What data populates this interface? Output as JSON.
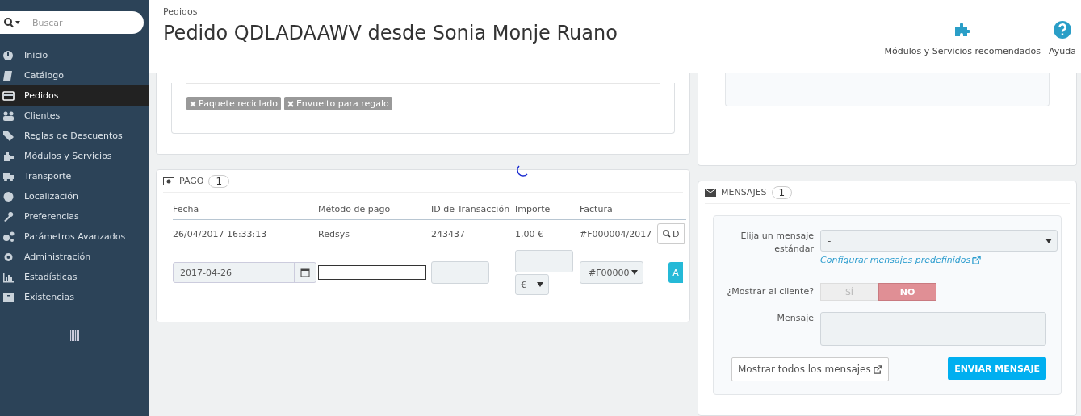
{
  "sidebar": {
    "search": {
      "placeholder": "Buscar"
    },
    "items": [
      {
        "label": "Inicio",
        "selected": false
      },
      {
        "label": "Catálogo",
        "selected": false
      },
      {
        "label": "Pedidos",
        "selected": true
      },
      {
        "label": "Clientes",
        "selected": false
      },
      {
        "label": "Reglas de Descuentos",
        "selected": false
      },
      {
        "label": "Módulos y Servicios",
        "selected": false
      },
      {
        "label": "Transporte",
        "selected": false
      },
      {
        "label": "Localización",
        "selected": false
      },
      {
        "label": "Preferencias",
        "selected": false
      },
      {
        "label": "Parámetros Avanzados",
        "selected": false
      },
      {
        "label": "Administración",
        "selected": false
      },
      {
        "label": "Estadísticas",
        "selected": false
      },
      {
        "label": "Existencias",
        "selected": false
      }
    ]
  },
  "header": {
    "breadcrumb": "Pedidos",
    "title": "Pedido QDLADAAWV desde Sonia Monje Ruano",
    "actions": [
      "Módulos y Servicios recomendados",
      "Ayuda"
    ]
  },
  "order_tags": [
    "Paquete reciclado",
    "Envuelto para regalo"
  ],
  "payment": {
    "title": "PAGO",
    "count": "1",
    "columns": [
      "Fecha",
      "Método de pago",
      "ID de Transacción",
      "Importe",
      "Factura"
    ],
    "rows": [
      {
        "date": "26/04/2017 16:33:13",
        "method": "Redsys",
        "transaction_id": "243437",
        "amount": "1,00 €",
        "invoice": "#F000004/2017",
        "button": "D"
      }
    ],
    "new_payment": {
      "date": "2017-04-26",
      "currency": "€",
      "invoice": "#F00000",
      "button": "A"
    }
  },
  "messages": {
    "title": "MENSAJES",
    "count": "1",
    "template_label": "Elija un mensaje estándar",
    "template_value": "-",
    "configure_link": "Configurar mensajes predefinidos",
    "show_label": "¿Mostrar al cliente?",
    "show_options": [
      {
        "label": "SÍ",
        "selected": false
      },
      {
        "label": "NO",
        "selected": true
      }
    ],
    "message_label": "Mensaje",
    "show_all_button": "Mostrar todos los mensajes",
    "send_button": "ENVIAR MENSAJE"
  }
}
